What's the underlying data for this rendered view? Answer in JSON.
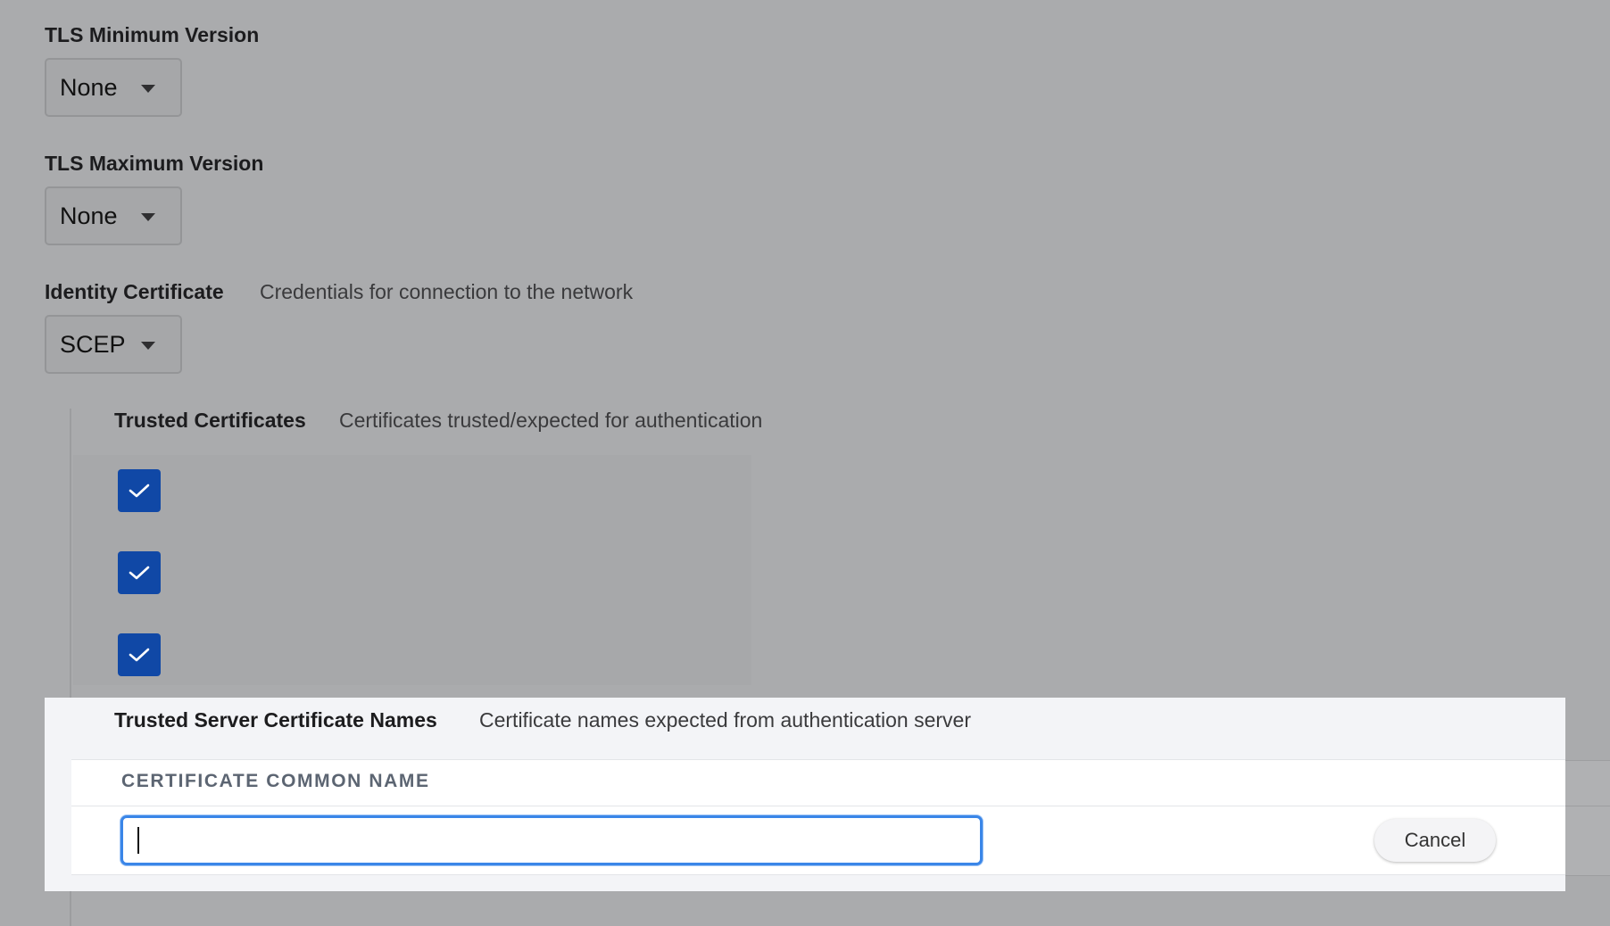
{
  "tls_min": {
    "label": "TLS Minimum Version",
    "value": "None"
  },
  "tls_max": {
    "label": "TLS Maximum Version",
    "value": "None"
  },
  "identity_certificate": {
    "label": "Identity Certificate",
    "description": "Credentials for connection to the network",
    "value": "SCEP"
  },
  "trusted_certificates": {
    "label": "Trusted Certificates",
    "description": "Certificates trusted/expected for authentication",
    "items": [
      {
        "checked": true
      },
      {
        "checked": true
      },
      {
        "checked": true
      }
    ]
  },
  "trusted_server_names": {
    "label": "Trusted Server Certificate Names",
    "description": "Certificate names expected from authentication server",
    "column_header": "CERTIFICATE COMMON NAME",
    "input_value": "",
    "cancel_label": "Cancel"
  },
  "colors": {
    "overlay": "#aaabad",
    "checkbox": "#1048a6",
    "focus_ring": "#3a86e8"
  }
}
